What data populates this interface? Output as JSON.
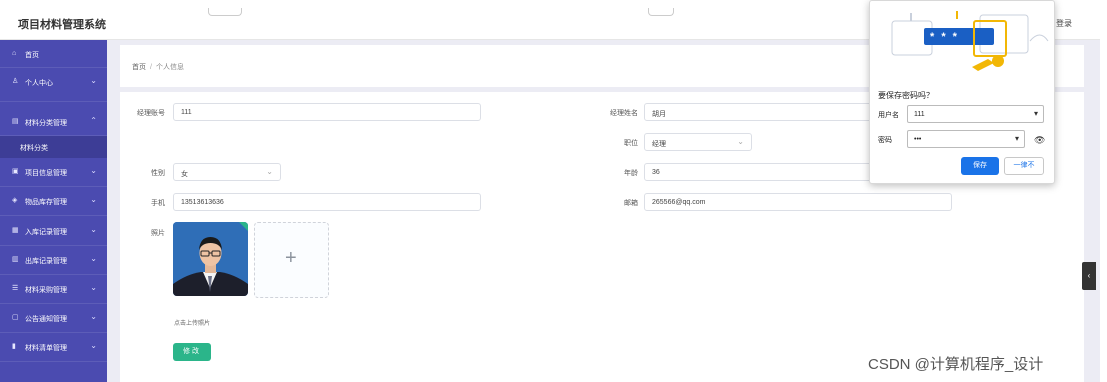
{
  "app": {
    "title": "项目材料管理系统",
    "logout_label": "登录"
  },
  "sidebar": {
    "items": [
      {
        "label": "首页",
        "icon": "home-icon",
        "glyph": "⌂",
        "expandable": false
      },
      {
        "label": "个人中心",
        "icon": "user-icon",
        "glyph": "♙",
        "expandable": true
      },
      {
        "label": "材料分类管理",
        "icon": "category-icon",
        "glyph": "▤",
        "expandable": true,
        "expanded": true
      },
      {
        "label": "项目信息管理",
        "icon": "project-icon",
        "glyph": "▣",
        "expandable": true
      },
      {
        "label": "物品库存管理",
        "icon": "inventory-icon",
        "glyph": "◈",
        "expandable": true
      },
      {
        "label": "入库记录管理",
        "icon": "inbound-icon",
        "glyph": "▦",
        "expandable": true
      },
      {
        "label": "出库记录管理",
        "icon": "outbound-icon",
        "glyph": "▥",
        "expandable": true
      },
      {
        "label": "材料采购管理",
        "icon": "purchase-icon",
        "glyph": "☰",
        "expandable": true
      },
      {
        "label": "公告通知管理",
        "icon": "notice-icon",
        "glyph": "▢",
        "expandable": true
      },
      {
        "label": "材料清单管理",
        "icon": "list-icon",
        "glyph": "▮",
        "expandable": true
      }
    ],
    "sub_item": "材料分类",
    "chevron_down": "⌄",
    "chevron_up": "⌃"
  },
  "breadcrumb": {
    "home": "首页",
    "separator": "/",
    "current": "个人信息"
  },
  "form": {
    "account_label": "经理账号",
    "account_value": "111",
    "name_label": "经理姓名",
    "name_value": "胡月",
    "position_label": "职位",
    "position_value": "经理",
    "gender_label": "性别",
    "gender_value": "女",
    "age_label": "年龄",
    "age_value": "36",
    "phone_label": "手机",
    "phone_value": "13513613636",
    "email_label": "邮箱",
    "email_value": "265566@qq.com",
    "photo_label": "照片",
    "upload_plus": "+",
    "upload_tip": "点击上传照片",
    "submit_label": "修改"
  },
  "password_popup": {
    "title": "要保存密码吗？",
    "username_label": "用户名",
    "username_value": "111",
    "password_label": "密码",
    "password_value": "•••",
    "masked_display": "* * *",
    "save_label": "保存",
    "never_label": "一律不"
  },
  "watermark": "CSDN @计算机程序_设计",
  "colors": {
    "sidebar": "#4b4bb0",
    "submit": "#2bb58a",
    "save": "#1a73e8"
  }
}
